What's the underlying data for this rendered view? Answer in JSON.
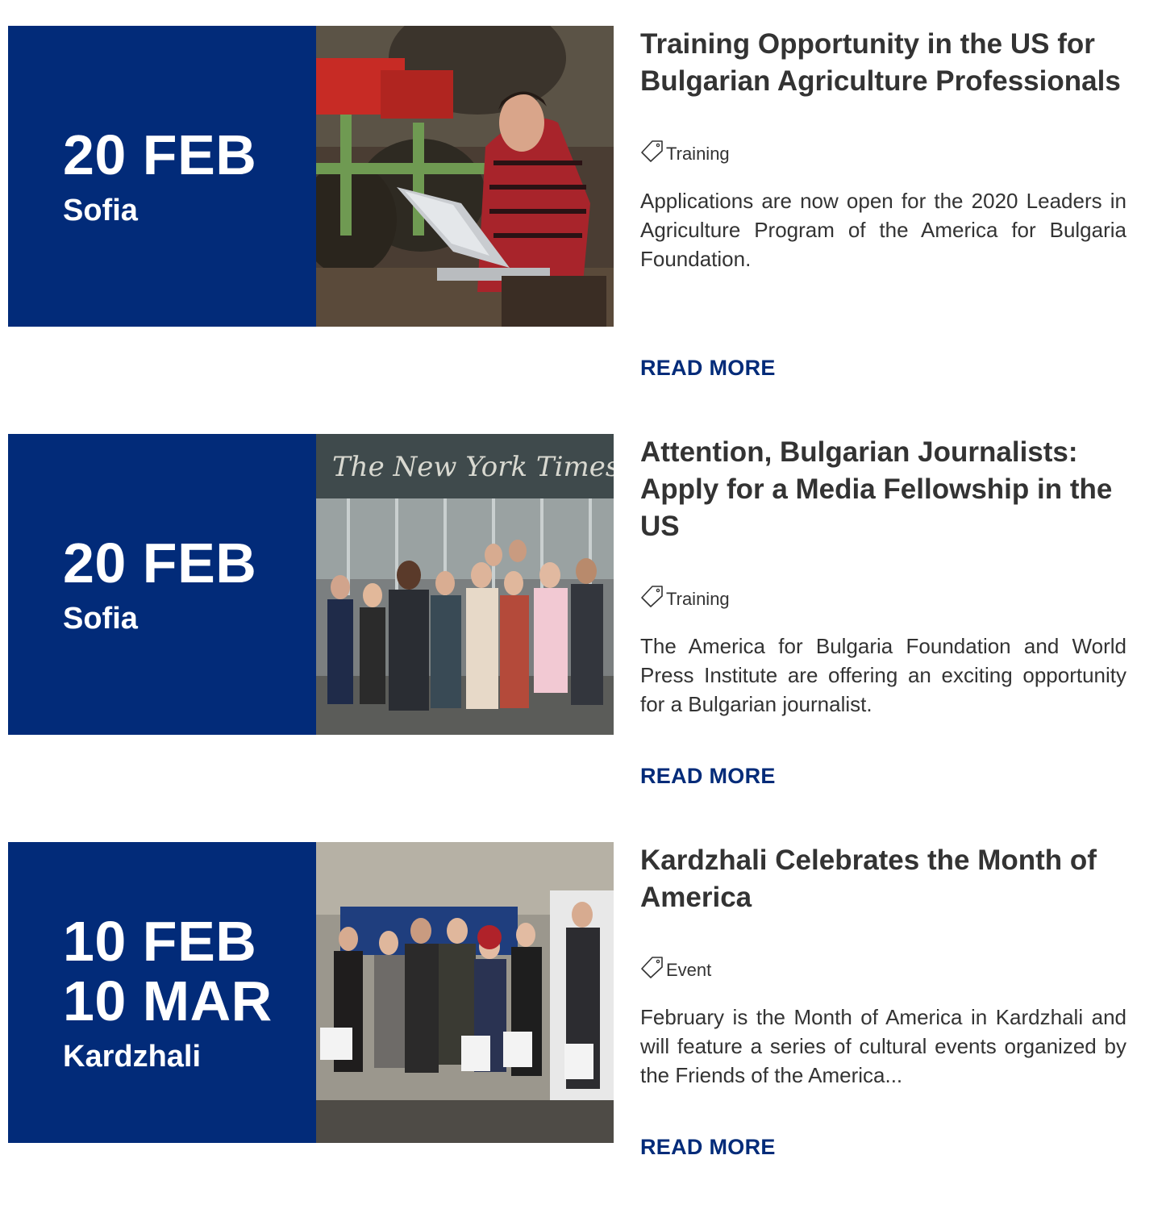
{
  "items": [
    {
      "date_lines": [
        "20 FEB"
      ],
      "city": "Sofia",
      "title": "Training Opportunity in the US for Bulgarian Agriculture Professionals",
      "category": "Training",
      "summary": "Applications are now open for the 2020 Leaders in Agriculture Program of the America for Bulgaria Foundation.",
      "read_more": "READ MORE"
    },
    {
      "date_lines": [
        "20 FEB"
      ],
      "city": "Sofia",
      "title": "Attention, Bulgarian Journalists: Apply for a Media Fellowship in the US",
      "category": "Training",
      "summary": "The America for Bulgaria Foundation and World Press Institute are offering an exciting opportunity for a Bulgarian journalist.",
      "read_more": "READ MORE",
      "photo_sign": "The New York Times"
    },
    {
      "date_lines": [
        "10 FEB",
        "10 MAR"
      ],
      "city": "Kardzhali",
      "title": "Kardzhali Celebrates the Month of America",
      "category": "Event",
      "summary": "February is the Month of America in Kardzhali and will feature a series of cultural events organized by the Friends of the America...",
      "read_more": "READ MORE"
    }
  ],
  "colors": {
    "accent": "#022b79",
    "text": "#333333"
  },
  "icons": {
    "tag": "tag-icon"
  }
}
